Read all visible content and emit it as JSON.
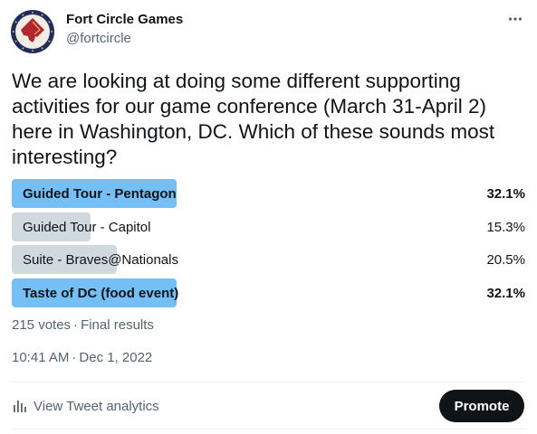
{
  "account": {
    "name": "Fort Circle Games",
    "handle": "@fortcircle"
  },
  "tweet": {
    "text": "We are looking at doing some different supporting activities for our game conference (March 31-April 2) here in Washington, DC. Which of these sounds most interesting?"
  },
  "poll": {
    "options": [
      {
        "label": "Guided Tour - Pentagon",
        "percent_text": "32.1%",
        "percent": 32.1,
        "winner": true
      },
      {
        "label": "Guided Tour - Capitol",
        "percent_text": "15.3%",
        "percent": 15.3,
        "winner": false
      },
      {
        "label": "Suite - Braves@Nationals",
        "percent_text": "20.5%",
        "percent": 20.5,
        "winner": false
      },
      {
        "label": "Taste of DC (food event)",
        "percent_text": "32.1%",
        "percent": 32.1,
        "winner": true
      }
    ],
    "votes": "215 votes",
    "status": "Final results"
  },
  "timestamp": {
    "time": "10:41 AM",
    "date": "Dec 1, 2022"
  },
  "footer": {
    "analytics_label": "View Tweet analytics",
    "promote_label": "Promote"
  },
  "colors": {
    "winner_bar": "#74bff5",
    "other_bar": "#cfd9de",
    "text_secondary": "#536471",
    "promote_bg": "#0f1419"
  },
  "icons": {
    "more": "more-dots-icon",
    "analytics": "bar-chart-icon",
    "avatar": "dc-map-seal-icon"
  }
}
